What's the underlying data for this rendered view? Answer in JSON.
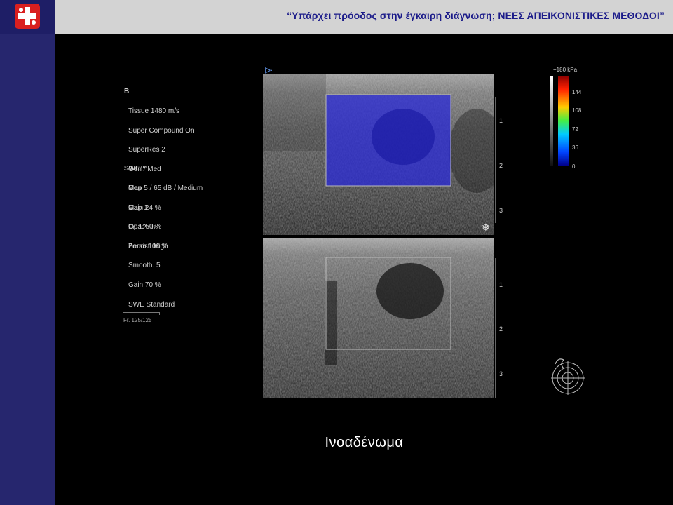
{
  "header": {
    "title": "“Υπάρχει πρόοδος στην έγκαιρη διάγνωση;  ΝΕΕΣ ΑΠΕΙΚΟΝΙΣΤΙΚΕΣ  ΜΕΘΟΔΟΙ”"
  },
  "logo": {
    "icon": "red-cross-logo-icon"
  },
  "ultrasound": {
    "b_mode": {
      "heading": "B",
      "lines": [
        "Tissue 1480 m/s",
        "Super Compound On",
        "SuperRes 2",
        "Gen / Med",
        "Map 5 / 65 dB / Medium",
        "Gain 24 %",
        "Fr. 12 Hz",
        "Zoom 100 %"
      ]
    },
    "swe": {
      "heading": "SWE™",
      "lines": [
        "Gen",
        "Map 1",
        "Opa. 50 %",
        "Persist. High",
        "Smooth. 5",
        "Gain 70 %",
        "SWE Standard"
      ]
    },
    "frame_counter": "Fr. 125/125",
    "colorbar": {
      "top_label": "+180 kPa",
      "ticks": [
        "144",
        "108",
        "72",
        "36",
        "0"
      ]
    },
    "top_depth_ticks": [
      "1",
      "2",
      "3"
    ],
    "bottom_depth_ticks": [
      "1",
      "2",
      "3"
    ],
    "freeze_icon": "snowflake-icon",
    "probe_icon": "probe-orientation-icon",
    "colors": {
      "swe_overlay": "#2a2ad8",
      "roi_border": "#bbbbbb",
      "header_text": "#1c1c8a",
      "sidebar": "#26266e"
    }
  },
  "caption": "Ινοαδένωμα"
}
